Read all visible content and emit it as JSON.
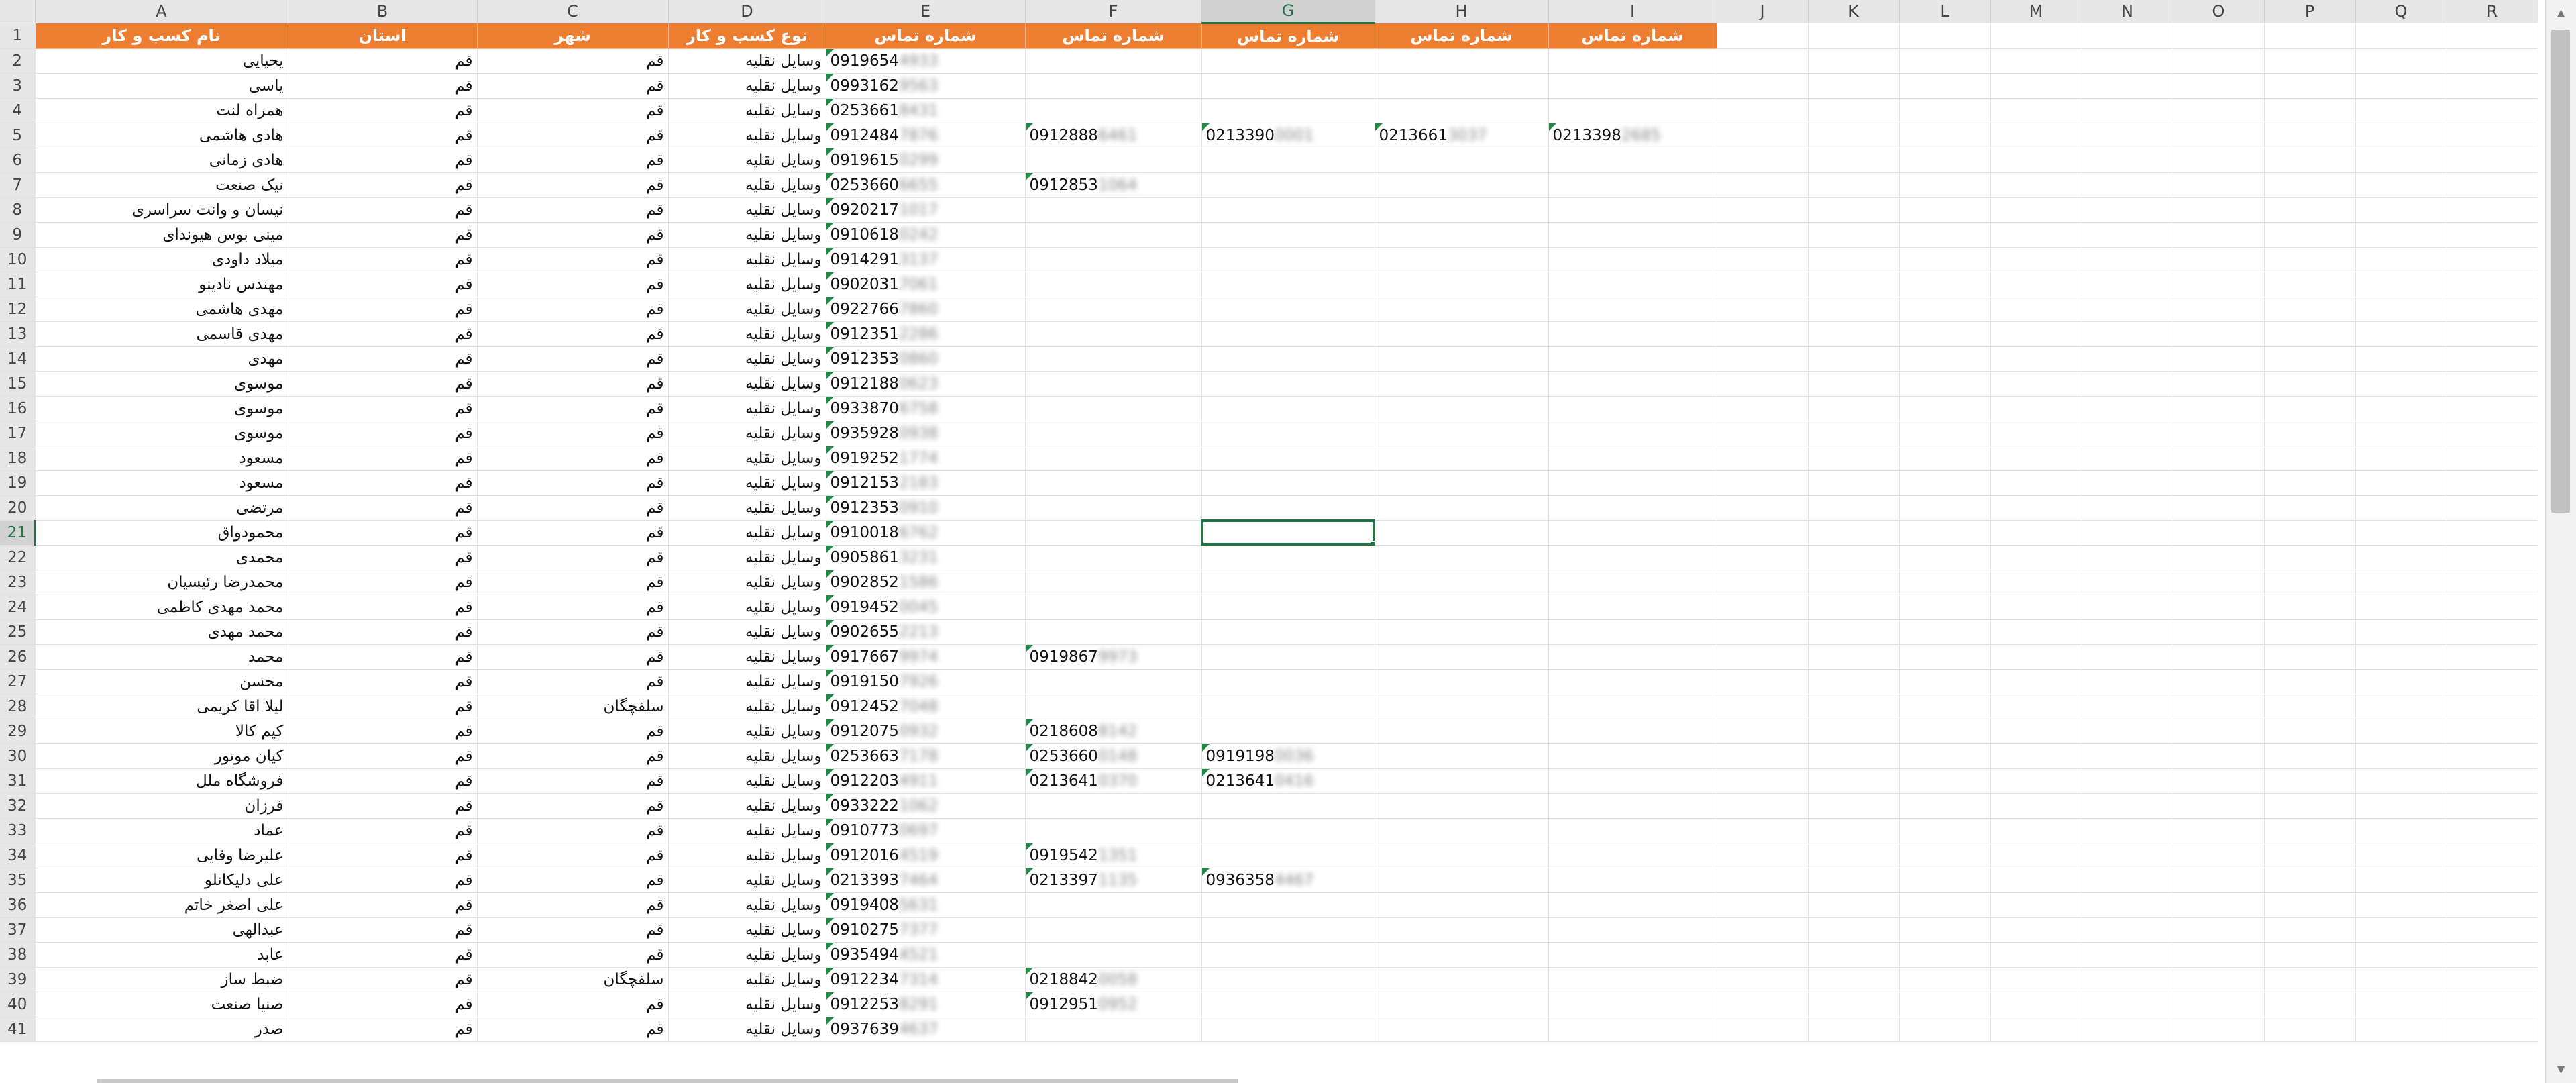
{
  "columns": [
    "A",
    "B",
    "C",
    "D",
    "E",
    "F",
    "G",
    "H",
    "I",
    "J",
    "K",
    "L",
    "M",
    "N",
    "O",
    "P",
    "Q",
    "R"
  ],
  "selected_column": "G",
  "selected_row": 21,
  "header_row": [
    "نام کسب و کار",
    "استان",
    "شهر",
    "نوع کسب و کار",
    "شماره تماس",
    "شماره تماس",
    "شماره تماس",
    "شماره تماس",
    "شماره تماس"
  ],
  "rows": [
    {
      "n": 2,
      "name": "یحیایی",
      "state": "قم",
      "city": "قم",
      "type": "وسایل نقلیه",
      "e": [
        "0919654",
        "4933"
      ],
      "f": null,
      "g": null,
      "h": null,
      "i": null
    },
    {
      "n": 3,
      "name": "یاسی",
      "state": "قم",
      "city": "قم",
      "type": "وسایل نقلیه",
      "e": [
        "0993162",
        "9563"
      ],
      "f": null,
      "g": null,
      "h": null,
      "i": null
    },
    {
      "n": 4,
      "name": "همراه لنت",
      "state": "قم",
      "city": "قم",
      "type": "وسایل نقلیه",
      "e": [
        "0253661",
        "8431"
      ],
      "f": null,
      "g": null,
      "h": null,
      "i": null
    },
    {
      "n": 5,
      "name": "هادی هاشمی",
      "state": "قم",
      "city": "قم",
      "type": "وسایل نقلیه",
      "e": [
        "0912484",
        "7876"
      ],
      "f": [
        "0912888",
        "6461"
      ],
      "g": [
        "0213390",
        "0001"
      ],
      "h": [
        "0213661",
        "3037"
      ],
      "i": [
        "0213398",
        "2685"
      ]
    },
    {
      "n": 6,
      "name": "هادی زمانی",
      "state": "قم",
      "city": "قم",
      "type": "وسایل نقلیه",
      "e": [
        "0919615",
        "0299"
      ],
      "f": null,
      "g": null,
      "h": null,
      "i": null
    },
    {
      "n": 7,
      "name": "نیک صنعت",
      "state": "قم",
      "city": "قم",
      "type": "وسایل نقلیه",
      "e": [
        "0253660",
        "6655"
      ],
      "f": [
        "0912853",
        "1064"
      ],
      "g": null,
      "h": null,
      "i": null
    },
    {
      "n": 8,
      "name": "نیسان و وانت سراسری",
      "state": "قم",
      "city": "قم",
      "type": "وسایل نقلیه",
      "e": [
        "0920217",
        "1017"
      ],
      "f": null,
      "g": null,
      "h": null,
      "i": null
    },
    {
      "n": 9,
      "name": "مینی بوس هیوندای",
      "state": "قم",
      "city": "قم",
      "type": "وسایل نقلیه",
      "e": [
        "0910618",
        "0242"
      ],
      "f": null,
      "g": null,
      "h": null,
      "i": null
    },
    {
      "n": 10,
      "name": "میلاد داودی",
      "state": "قم",
      "city": "قم",
      "type": "وسایل نقلیه",
      "e": [
        "0914291",
        "3137"
      ],
      "f": null,
      "g": null,
      "h": null,
      "i": null
    },
    {
      "n": 11,
      "name": "مهندس نادینو",
      "state": "قم",
      "city": "قم",
      "type": "وسایل نقلیه",
      "e": [
        "0902031",
        "7061"
      ],
      "f": null,
      "g": null,
      "h": null,
      "i": null
    },
    {
      "n": 12,
      "name": "مهدی هاشمی",
      "state": "قم",
      "city": "قم",
      "type": "وسایل نقلیه",
      "e": [
        "0922766",
        "7860"
      ],
      "f": null,
      "g": null,
      "h": null,
      "i": null
    },
    {
      "n": 13,
      "name": "مهدی قاسمی",
      "state": "قم",
      "city": "قم",
      "type": "وسایل نقلیه",
      "e": [
        "0912351",
        "2286"
      ],
      "f": null,
      "g": null,
      "h": null,
      "i": null
    },
    {
      "n": 14,
      "name": "مهدی",
      "state": "قم",
      "city": "قم",
      "type": "وسایل نقلیه",
      "e": [
        "0912353",
        "0860"
      ],
      "f": null,
      "g": null,
      "h": null,
      "i": null
    },
    {
      "n": 15,
      "name": "موسوی",
      "state": "قم",
      "city": "قم",
      "type": "وسایل نقلیه",
      "e": [
        "0912188",
        "0623"
      ],
      "f": null,
      "g": null,
      "h": null,
      "i": null
    },
    {
      "n": 16,
      "name": "موسوی",
      "state": "قم",
      "city": "قم",
      "type": "وسایل نقلیه",
      "e": [
        "0933870",
        "6758"
      ],
      "f": null,
      "g": null,
      "h": null,
      "i": null
    },
    {
      "n": 17,
      "name": "موسوی",
      "state": "قم",
      "city": "قم",
      "type": "وسایل نقلیه",
      "e": [
        "0935928",
        "0938"
      ],
      "f": null,
      "g": null,
      "h": null,
      "i": null
    },
    {
      "n": 18,
      "name": "مسعود",
      "state": "قم",
      "city": "قم",
      "type": "وسایل نقلیه",
      "e": [
        "0919252",
        "1774"
      ],
      "f": null,
      "g": null,
      "h": null,
      "i": null
    },
    {
      "n": 19,
      "name": "مسعود",
      "state": "قم",
      "city": "قم",
      "type": "وسایل نقلیه",
      "e": [
        "0912153",
        "2183"
      ],
      "f": null,
      "g": null,
      "h": null,
      "i": null
    },
    {
      "n": 20,
      "name": "مرتضی",
      "state": "قم",
      "city": "قم",
      "type": "وسایل نقلیه",
      "e": [
        "0912353",
        "0910"
      ],
      "f": null,
      "g": null,
      "h": null,
      "i": null
    },
    {
      "n": 21,
      "name": "محمودواق",
      "state": "قم",
      "city": "قم",
      "type": "وسایل نقلیه",
      "e": [
        "0910018",
        "6762"
      ],
      "f": null,
      "g": null,
      "h": null,
      "i": null
    },
    {
      "n": 22,
      "name": "محمدی",
      "state": "قم",
      "city": "قم",
      "type": "وسایل نقلیه",
      "e": [
        "0905861",
        "3231"
      ],
      "f": null,
      "g": null,
      "h": null,
      "i": null
    },
    {
      "n": 23,
      "name": "محمدرضا رئیسیان",
      "state": "قم",
      "city": "قم",
      "type": "وسایل نقلیه",
      "e": [
        "0902852",
        "1586"
      ],
      "f": null,
      "g": null,
      "h": null,
      "i": null
    },
    {
      "n": 24,
      "name": "محمد مهدی کاظمی",
      "state": "قم",
      "city": "قم",
      "type": "وسایل نقلیه",
      "e": [
        "0919452",
        "0045"
      ],
      "f": null,
      "g": null,
      "h": null,
      "i": null
    },
    {
      "n": 25,
      "name": "محمد مهدی",
      "state": "قم",
      "city": "قم",
      "type": "وسایل نقلیه",
      "e": [
        "0902655",
        "2213"
      ],
      "f": null,
      "g": null,
      "h": null,
      "i": null
    },
    {
      "n": 26,
      "name": "محمد",
      "state": "قم",
      "city": "قم",
      "type": "وسایل نقلیه",
      "e": [
        "0917667",
        "9974"
      ],
      "f": [
        "0919867",
        "9973"
      ],
      "g": null,
      "h": null,
      "i": null
    },
    {
      "n": 27,
      "name": "محسن",
      "state": "قم",
      "city": "قم",
      "type": "وسایل نقلیه",
      "e": [
        "0919150",
        "7926"
      ],
      "f": null,
      "g": null,
      "h": null,
      "i": null
    },
    {
      "n": 28,
      "name": "لیلا اقا کریمی",
      "state": "قم",
      "city": "سلفچگان",
      "type": "وسایل نقلیه",
      "e": [
        "0912452",
        "7048"
      ],
      "f": null,
      "g": null,
      "h": null,
      "i": null
    },
    {
      "n": 29,
      "name": "کیم کالا",
      "state": "قم",
      "city": "قم",
      "type": "وسایل نقلیه",
      "e": [
        "0912075",
        "0932"
      ],
      "f": [
        "0218608",
        "8142"
      ],
      "g": null,
      "h": null,
      "i": null
    },
    {
      "n": 30,
      "name": "کیان موتور",
      "state": "قم",
      "city": "قم",
      "type": "وسایل نقلیه",
      "e": [
        "0253663",
        "7178"
      ],
      "f": [
        "0253660",
        "0148"
      ],
      "g": [
        "0919198",
        "0036"
      ],
      "h": null,
      "i": null
    },
    {
      "n": 31,
      "name": "فروشگاه ملل",
      "state": "قم",
      "city": "قم",
      "type": "وسایل نقلیه",
      "e": [
        "0912203",
        "4911"
      ],
      "f": [
        "0213641",
        "0370"
      ],
      "g": [
        "0213641",
        "0416"
      ],
      "h": null,
      "i": null
    },
    {
      "n": 32,
      "name": "فرزان",
      "state": "قم",
      "city": "قم",
      "type": "وسایل نقلیه",
      "e": [
        "0933222",
        "1062"
      ],
      "f": null,
      "g": null,
      "h": null,
      "i": null
    },
    {
      "n": 33,
      "name": "عماد",
      "state": "قم",
      "city": "قم",
      "type": "وسایل نقلیه",
      "e": [
        "0910773",
        "0697"
      ],
      "f": null,
      "g": null,
      "h": null,
      "i": null
    },
    {
      "n": 34,
      "name": "علیرضا وفایی",
      "state": "قم",
      "city": "قم",
      "type": "وسایل نقلیه",
      "e": [
        "0912016",
        "4519"
      ],
      "f": [
        "0919542",
        "1351"
      ],
      "g": null,
      "h": null,
      "i": null
    },
    {
      "n": 35,
      "name": "علی دلیکانلو",
      "state": "قم",
      "city": "قم",
      "type": "وسایل نقلیه",
      "e": [
        "0213393",
        "7464"
      ],
      "f": [
        "0213397",
        "1135"
      ],
      "g": [
        "0936358",
        "4467"
      ],
      "h": null,
      "i": null
    },
    {
      "n": 36,
      "name": "علی اصغر خاتم",
      "state": "قم",
      "city": "قم",
      "type": "وسایل نقلیه",
      "e": [
        "0919408",
        "5631"
      ],
      "f": null,
      "g": null,
      "h": null,
      "i": null
    },
    {
      "n": 37,
      "name": "عبدالهی",
      "state": "قم",
      "city": "قم",
      "type": "وسایل نقلیه",
      "e": [
        "0910275",
        "7377"
      ],
      "f": null,
      "g": null,
      "h": null,
      "i": null
    },
    {
      "n": 38,
      "name": "عابد",
      "state": "قم",
      "city": "قم",
      "type": "وسایل نقلیه",
      "e": [
        "0935494",
        "4521"
      ],
      "f": null,
      "g": null,
      "h": null,
      "i": null
    },
    {
      "n": 39,
      "name": "ضبط ساز",
      "state": "قم",
      "city": "سلفچگان",
      "type": "وسایل نقلیه",
      "e": [
        "0912234",
        "7314"
      ],
      "f": [
        "0218842",
        "0058"
      ],
      "g": null,
      "h": null,
      "i": null
    },
    {
      "n": 40,
      "name": "صنیا صنعت",
      "state": "قم",
      "city": "قم",
      "type": "وسایل نقلیه",
      "e": [
        "0912253",
        "8291"
      ],
      "f": [
        "0912951",
        "0952"
      ],
      "g": null,
      "h": null,
      "i": null
    },
    {
      "n": 41,
      "name": "صدر",
      "state": "قم",
      "city": "قم",
      "type": "وسایل نقلیه",
      "e": [
        "0937639",
        "4637"
      ],
      "f": null,
      "g": null,
      "h": null,
      "i": null
    }
  ],
  "colors": {
    "header_fill": "#ed7d31",
    "selection": "#217346"
  }
}
